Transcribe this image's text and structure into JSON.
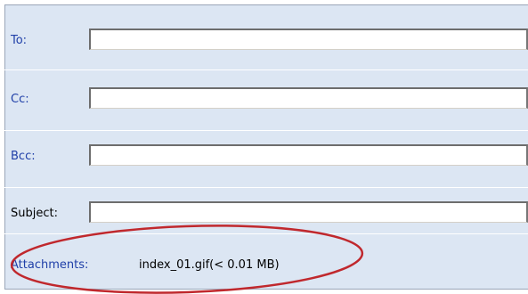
{
  "form": {
    "to_label": "To:",
    "cc_label": "Cc:",
    "bcc_label": "Bcc:",
    "subject_label": "Subject:",
    "to_value": "",
    "cc_value": "",
    "bcc_value": "",
    "subject_value": ""
  },
  "attachments": {
    "label": "Attachments:",
    "file": "index_01.gif(< 0.01 MB)"
  },
  "colors": {
    "panel_background": "#dce6f3",
    "label_blue": "#1f3fa8",
    "highlight_ellipse": "#c0282d"
  }
}
